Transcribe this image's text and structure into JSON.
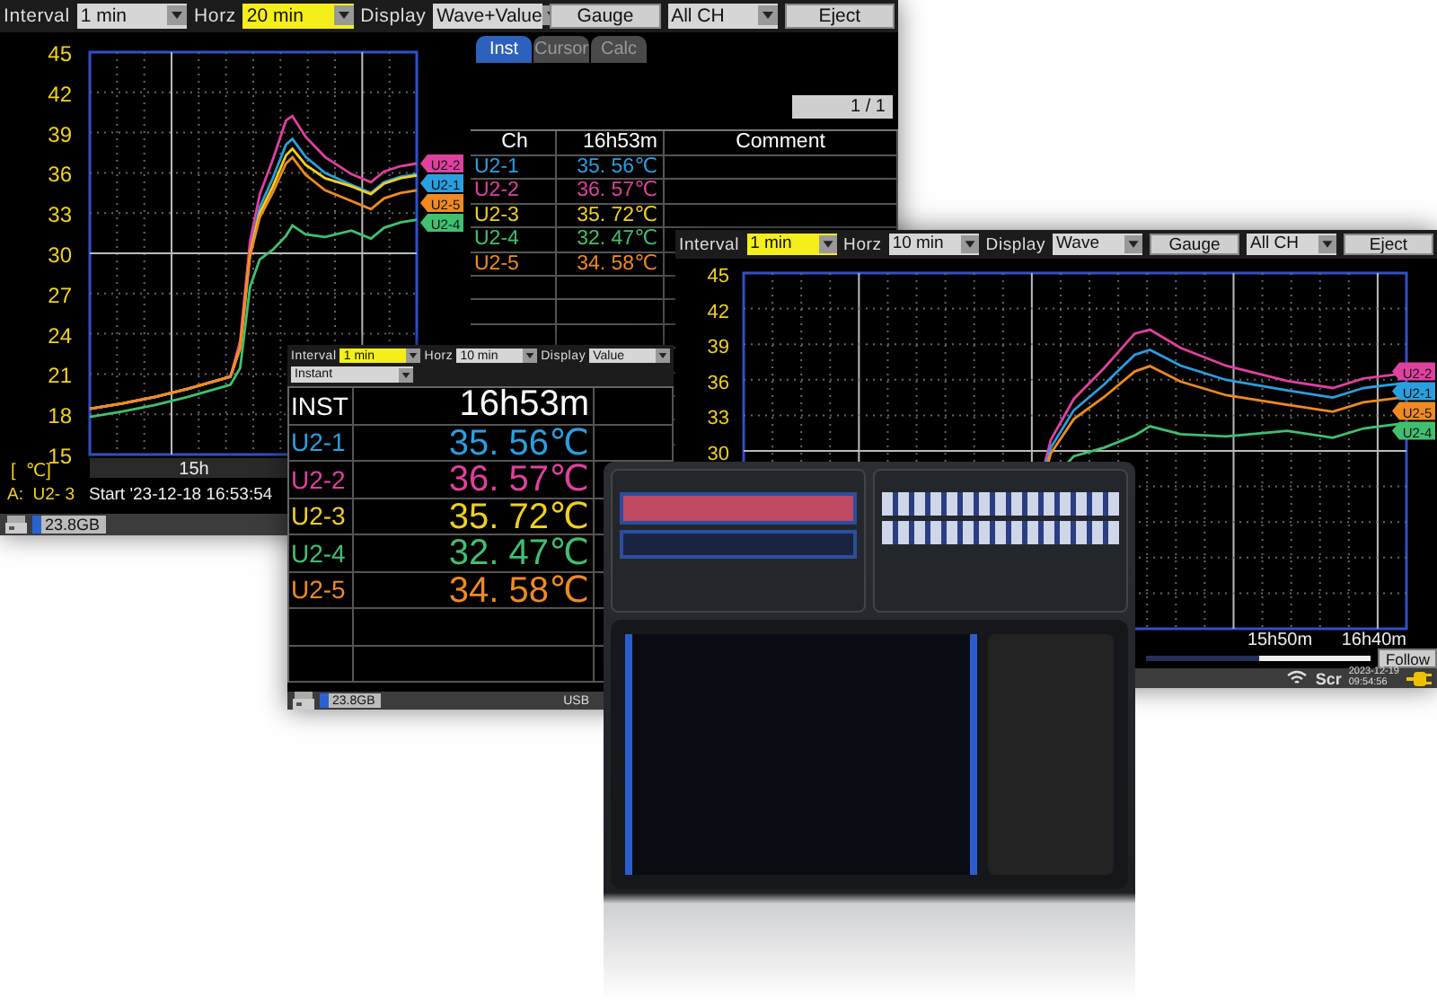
{
  "wave_value_screen": {
    "toolbar": [
      {
        "kind": "dropdown",
        "label": "Interval",
        "value": "1 min",
        "focused": false
      },
      {
        "kind": "dropdown",
        "label": "Horz",
        "value": "20 min",
        "focused": true
      },
      {
        "kind": "dropdown",
        "label": "Display",
        "value": "Wave+Value",
        "focused": false
      },
      {
        "kind": "button",
        "label": "Gauge"
      },
      {
        "kind": "dropdown",
        "value": "All CH",
        "focused": false
      },
      {
        "kind": "button",
        "label": "Eject"
      }
    ],
    "y_ticks": [
      "45",
      "42",
      "39",
      "36",
      "33",
      "30",
      "27",
      "24",
      "21",
      "18",
      "15"
    ],
    "unit": "[  ℃]",
    "x_labels": [
      "15h"
    ],
    "wave_tags": [
      {
        "label": "U2-2",
        "color": "#e040a0"
      },
      {
        "label": "U2-1",
        "color": "#2a9fe0"
      },
      {
        "label": "U2-5",
        "color": "#f08a20"
      },
      {
        "label": "U2-4",
        "color": "#40c070"
      }
    ],
    "cursor_channel": "A:  U2- 3",
    "start": "Start '23-12-18 16:53:54",
    "tabs": [
      {
        "label": "Inst",
        "selected": true
      },
      {
        "label": "Cursor",
        "selected": false
      },
      {
        "label": "Calc",
        "selected": false
      }
    ],
    "page": "1 / 1",
    "table": {
      "columns": [
        "Ch",
        "16h53m",
        "Comment"
      ],
      "rows": [
        {
          "ch": "U2-1",
          "value": "35. 56℃",
          "color": "#2a9fe0"
        },
        {
          "ch": "U2-2",
          "value": "36. 57℃",
          "color": "#e040a0"
        },
        {
          "ch": "U2-3",
          "value": "35. 72℃",
          "color": "#f0d020"
        },
        {
          "ch": "U2-4",
          "value": "32. 47℃",
          "color": "#40c070"
        },
        {
          "ch": "U2-5",
          "value": "34. 58℃",
          "color": "#f08a20"
        }
      ]
    },
    "storage": "23.8GB"
  },
  "value_screen": {
    "toolbar": [
      {
        "kind": "dropdown",
        "label": "Interval",
        "value": "1 min",
        "focused": true
      },
      {
        "kind": "dropdown",
        "label": "Horz",
        "value": "10 min",
        "focused": false
      },
      {
        "kind": "dropdown",
        "label": "Display",
        "value": "Value",
        "focused": false
      }
    ],
    "mode": "Instant",
    "table": {
      "columns": [
        "INST",
        "16h53m"
      ],
      "rows": [
        {
          "ch": "U2-1",
          "value": "35. 56℃",
          "color": "#2a9fe0"
        },
        {
          "ch": "U2-2",
          "value": "36. 57℃",
          "color": "#e040a0"
        },
        {
          "ch": "U2-3",
          "value": "35. 72℃",
          "color": "#f0d020"
        },
        {
          "ch": "U2-4",
          "value": "32. 47℃",
          "color": "#40c070"
        },
        {
          "ch": "U2-5",
          "value": "34. 58℃",
          "color": "#f08a20"
        }
      ]
    },
    "storage": "23.8GB",
    "usb": "USB"
  },
  "wave_screen": {
    "toolbar": [
      {
        "kind": "dropdown",
        "label": "Interval",
        "value": "1 min",
        "focused": true
      },
      {
        "kind": "dropdown",
        "label": "Horz",
        "value": "10 min",
        "focused": false
      },
      {
        "kind": "dropdown",
        "label": "Display",
        "value": "Wave",
        "focused": false
      },
      {
        "kind": "button",
        "label": "Gauge"
      },
      {
        "kind": "dropdown",
        "value": "All CH",
        "focused": false
      },
      {
        "kind": "button",
        "label": "Eject"
      }
    ],
    "y_ticks": [
      "45",
      "42",
      "39",
      "36",
      "33",
      "30"
    ],
    "wave_tags": [
      {
        "label": "U2-2",
        "color": "#e040a0"
      },
      {
        "label": "U2-1",
        "color": "#2a9fe0"
      },
      {
        "label": "U2-5",
        "color": "#f08a20"
      },
      {
        "label": "U2-4",
        "color": "#40c070"
      }
    ],
    "x_labels": [
      "15h50m",
      "16h40m"
    ],
    "follow": "Follow",
    "status": {
      "screen": "Scr",
      "date": "2023-12-19",
      "time": "09:54:56"
    }
  }
}
